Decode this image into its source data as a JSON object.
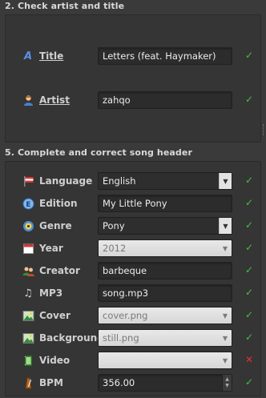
{
  "section2": {
    "header": "2. Check artist and title",
    "title_label": "Title",
    "title_underline": "T",
    "title_value": "Letters (feat. Haymaker)",
    "artist_label": "Artist",
    "artist_underline": "A",
    "artist_value": "zahqo"
  },
  "section5": {
    "header": "5. Complete and correct song header",
    "rows": [
      {
        "label": "Language",
        "value": "English",
        "icon": "flag-icon",
        "status": "ok"
      },
      {
        "label": "Edition",
        "value": "My Little Pony",
        "icon": "edition-icon",
        "status": "ok"
      },
      {
        "label": "Genre",
        "value": "Pony",
        "icon": "genre-icon",
        "status": "ok"
      },
      {
        "label": "Year",
        "value": "2012",
        "icon": "calendar-icon",
        "status": "ok"
      },
      {
        "label": "Creator",
        "value": "barbeque",
        "icon": "creator-icon",
        "status": "ok"
      },
      {
        "label": "MP3",
        "value": "song.mp3",
        "icon": "music-note-icon",
        "status": "ok"
      },
      {
        "label": "Cover",
        "value": "cover.png",
        "icon": "image-icon",
        "status": "ok"
      },
      {
        "label": "Background",
        "value": "still.png",
        "icon": "background-image-icon",
        "status": "ok"
      },
      {
        "label": "Video",
        "value": "",
        "icon": "video-icon",
        "status": "error"
      },
      {
        "label": "BPM",
        "value": "356.00",
        "icon": "metronome-icon",
        "status": "ok"
      }
    ]
  },
  "status_marks": {
    "ok": "✓",
    "error": "✕"
  },
  "colors": {
    "ok": "#3fc43f",
    "error": "#e03030",
    "background": "#3a3a3a"
  }
}
